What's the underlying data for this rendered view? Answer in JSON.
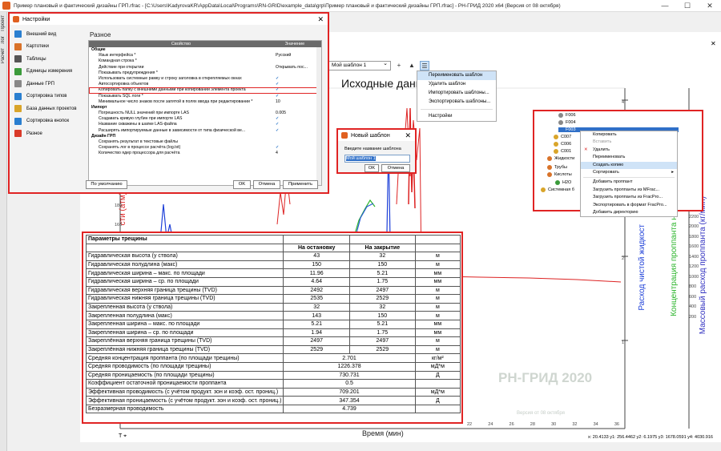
{
  "window": {
    "title": "Пример плановый и фактический дизайны ГРП.rfrac - [C:\\Users\\KadyrovaKR\\AppData\\Local\\Programs\\RN-GRID\\example_data\\grp\\Пример плановый и фактический дизайны ГРП.rfrac] - РН-ГРИД 2020 x64 (Версия от 08 октября)",
    "left_tabs": [
      "Проект",
      "Лог",
      "Расчет"
    ]
  },
  "settings_dialog": {
    "title": "Настройки",
    "nav": [
      {
        "label": "Внешний вид",
        "icon": "appearance-icon",
        "color": "#2a7fd0"
      },
      {
        "label": "Картотеки",
        "icon": "cards-icon",
        "color": "#d9732a"
      },
      {
        "label": "Таблицы",
        "icon": "table-icon",
        "color": "#555555"
      },
      {
        "label": "Единицы измерения",
        "icon": "units-icon",
        "color": "#3b9b3b"
      },
      {
        "label": "Данные ГРП",
        "icon": "frac-data-icon",
        "color": "#888888"
      },
      {
        "label": "Сортировка типов",
        "icon": "sort-types-icon",
        "color": "#2a7fd0"
      },
      {
        "label": "База данных проектов",
        "icon": "database-icon",
        "color": "#d9a52a"
      },
      {
        "label": "Сортировка кнопок",
        "icon": "sort-buttons-icon",
        "color": "#2a7fd0"
      },
      {
        "label": "Разное",
        "icon": "misc-icon",
        "color": "#d93b2a"
      }
    ],
    "section": "Разное",
    "col_property": "Свойство",
    "col_value": "Значение",
    "rows": [
      {
        "group": true,
        "p": "Общие",
        "v": ""
      },
      {
        "p": "Язык интерфейса *",
        "v": "Русский"
      },
      {
        "p": "Командная строка *",
        "v": ""
      },
      {
        "p": "Действие при открытии",
        "v": "Открывать пос..."
      },
      {
        "p": "Показывать предупреждения *",
        "v": ""
      },
      {
        "p": "Использовать системные рамку и строку заголовка в открепляемых окнах",
        "v": "✓"
      },
      {
        "p": "Автосортировка объектов",
        "v": "✓"
      },
      {
        "p": "Копировать папку с внешними данными при копировании элемента проекта",
        "v": "✓",
        "hl": true
      },
      {
        "p": "Показывать SQL логи *",
        "v": "✓"
      },
      {
        "p": "Минимальное число знаков после запятой в полях ввода при редактировании *",
        "v": "10"
      },
      {
        "group": true,
        "p": "Импорт",
        "v": ""
      },
      {
        "p": "Погрешность NULL значений при импорте LAS",
        "v": "0.005"
      },
      {
        "p": "Создавать кривую глубин при импорте LAS",
        "v": "✓"
      },
      {
        "p": "Название скважины в шапке LAS-файла",
        "v": "✓"
      },
      {
        "p": "Расширять импортируемые данные в зависимости от типа физической ве...",
        "v": "✓"
      },
      {
        "group": true,
        "p": "Дизайн ГРП",
        "v": ""
      },
      {
        "p": "Сохранять результат в текстовые файлы",
        "v": ""
      },
      {
        "p": "Сохранять лог в процессе расчёта (log.txt)",
        "v": "✓"
      },
      {
        "p": "Количество ядер процессора для расчёта",
        "v": "4"
      }
    ],
    "btn_default": "По умолчанию",
    "btn_ok": "OK",
    "btn_cancel": "Отмена",
    "btn_apply": "Применить"
  },
  "toolbar": {
    "template_select": "Мой шаблон 1"
  },
  "template_menu": {
    "items": [
      "Переименовать шаблон",
      "Удалить шаблон",
      "Импортировать шаблоны...",
      "Экспортировать шаблоны...",
      "Настройки"
    ]
  },
  "new_template_dialog": {
    "title": "Новый шаблон",
    "prompt": "Введите название шаблона",
    "value": "Мой шаблон 1",
    "ok": "OK",
    "cancel": "Отмена"
  },
  "chart": {
    "title": "Исходные данн",
    "y_left_label": "сти (атм)",
    "xlabel": "Время (мин)",
    "right_labels": [
      "Расход чистой жидкост",
      "Концентрация проппанта на по",
      "Массовый расход проппанта (кг/мин)"
    ],
    "watermark": "РН-ГРИД 2020",
    "watermark2": "Версия от 08 октября",
    "statusline": "x: 20.4133  y1: 256.4462  y2: 6.1975  y3: 1678.0591  y4: 4030.916",
    "left_ticks": [
      "180",
      "160"
    ],
    "right_ticks_a": [
      "4",
      "3",
      "2",
      "1"
    ],
    "right_ticks_b": [
      "2500",
      "2200",
      "2000",
      "1800",
      "1600",
      "1400",
      "1200",
      "1000",
      "800",
      "600",
      "400",
      "200"
    ],
    "x_ticks": [
      "22",
      "24",
      "26",
      "28",
      "30",
      "32",
      "34",
      "36"
    ]
  },
  "tree": {
    "nodes": [
      {
        "label": "F006",
        "color": "#888888"
      },
      {
        "label": "F004",
        "color": "#888888"
      },
      {
        "label": "F003",
        "color": "#3070c8",
        "sel": true
      },
      {
        "label": "C007",
        "color": "#d9a52a"
      },
      {
        "label": "C006",
        "color": "#d9a52a"
      },
      {
        "label": "C001",
        "color": "#d9a52a"
      },
      {
        "label": "Жидкости",
        "color": "#d9732a"
      },
      {
        "label": "Трубы",
        "color": "#d9732a"
      },
      {
        "label": "Кислоты",
        "color": "#d9732a"
      },
      {
        "label": "H2O",
        "color": "#3b9b3b"
      },
      {
        "label": "Системная б",
        "color": "#d9a52a"
      }
    ]
  },
  "context_menu": {
    "items": [
      "Копировать",
      "Вставить",
      "Удалить",
      "Переименовать",
      "Создать копию",
      "Сортировать",
      "Добавить проппант",
      "Загрузить проппанты из MFrac...",
      "Загрузить проппанты из FracPro...",
      "Экспортировать в формат FracPro...",
      "Добавить директорию"
    ]
  },
  "params": {
    "header": "Параметры трещины",
    "col_stop": "На остановку",
    "col_close": "На закрытие",
    "rows": [
      [
        "Гидравлическая  высота (у ствола)",
        "43",
        "32",
        "м"
      ],
      [
        "Гидравлическая  полудлина (макс)",
        "150",
        "150",
        "м"
      ],
      [
        "Гидравлическая  ширина – макс. по площади",
        "11.96",
        "5.21",
        "мм"
      ],
      [
        "Гидравлическая  ширина – ср. по площади",
        "4.64",
        "1.75",
        "мм"
      ],
      [
        "Гидравлическая верхняя граница трещины (TVD)",
        "2492",
        "2497",
        "м"
      ],
      [
        "Гидравлическая нижняя граница трещины (TVD)",
        "2535",
        "2529",
        "м"
      ],
      [
        "Закрепленная  высота (у ствола)",
        "32",
        "32",
        "м"
      ],
      [
        "Закрепленная  полудлина (макс)",
        "143",
        "150",
        "м"
      ],
      [
        "Закрепленная  ширина – макс. по площади",
        "5.21",
        "5.21",
        "мм"
      ],
      [
        "Закрепленная  ширина – ср. по площади",
        "1.94",
        "1.75",
        "мм"
      ],
      [
        "Закреплённая верхняя граница трещины (TVD)",
        "2497",
        "2497",
        "м"
      ],
      [
        "Закреплённая  нижняя граница трещины (TVD)",
        "2529",
        "2529",
        "м"
      ]
    ],
    "rows_single": [
      [
        "Средняя концентрация  проппанта (по площади трещины)",
        "2.701",
        "кг/м²"
      ],
      [
        "Средняя проводимость (по площади трещины)",
        "1226.378",
        "мД*м"
      ],
      [
        "Средняя проницаемость (по площади трещины)",
        "730.731",
        "Д"
      ],
      [
        "Коэффициент  остаточной проницаемости проппанта",
        "0.5",
        ""
      ],
      [
        "Эффективная  проводимость (с учётом продукт. зон и коэф. ост. прониц.)",
        "709.201",
        "мД*м"
      ],
      [
        "Эффективная  проницаемость  (с учётом продукт. зон и коэф. ост. прониц.)",
        "347.354",
        "Д"
      ],
      [
        "Безразмерная  проводимость",
        "4.739",
        ""
      ]
    ]
  }
}
